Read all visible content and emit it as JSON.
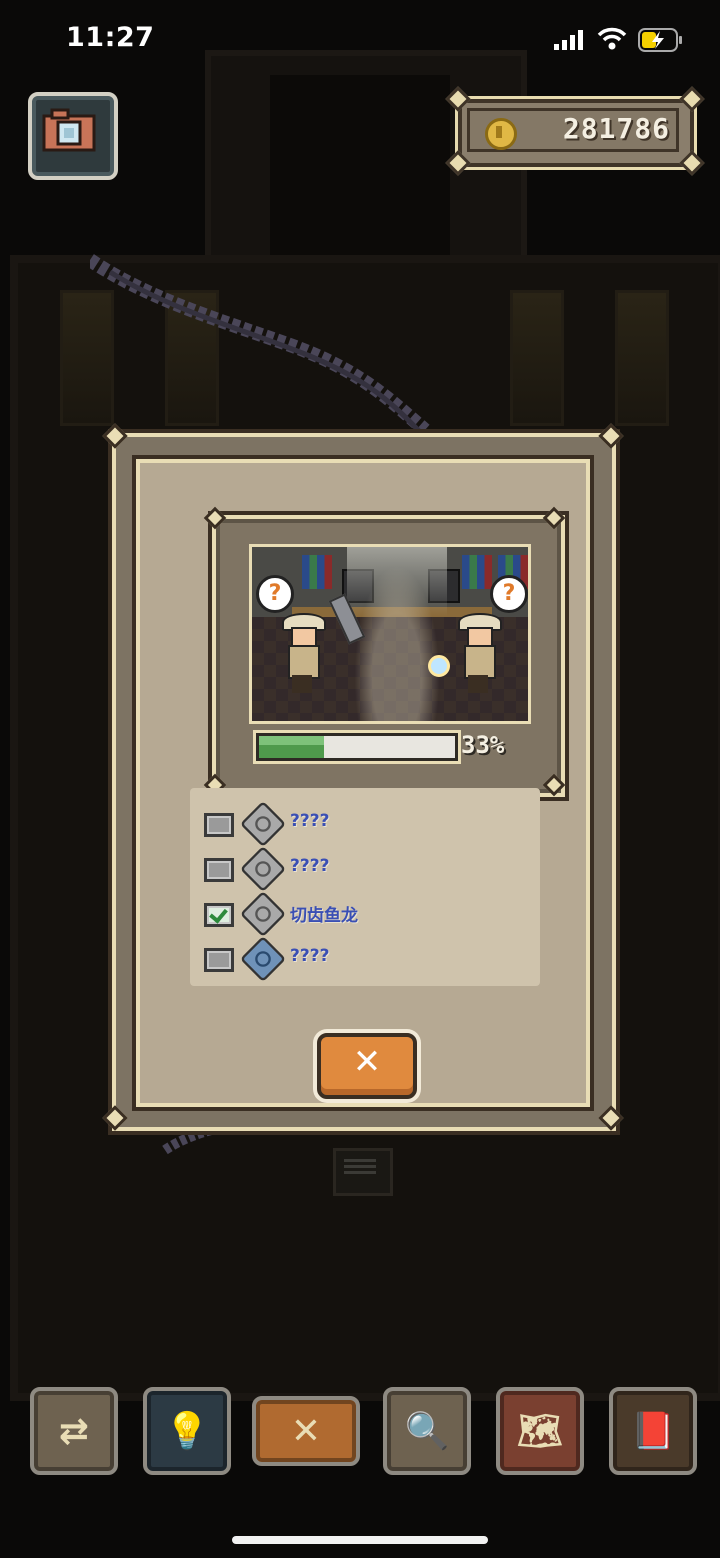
{
  "status_bar": {
    "time": "11:27"
  },
  "hud": {
    "coins": "281786",
    "camera_icon": "camera-icon",
    "coin_icon": "coin-icon"
  },
  "dialog": {
    "progress_percent": 33,
    "progress_label": "33%",
    "fossils": [
      {
        "name": "????",
        "checked": false,
        "icon": "fossil-gray-icon"
      },
      {
        "name": "????",
        "checked": false,
        "icon": "fossil-gray-icon"
      },
      {
        "name": "切齿鱼龙",
        "checked": true,
        "icon": "fossil-gray-icon"
      },
      {
        "name": "????",
        "checked": false,
        "icon": "fossil-blue-icon"
      }
    ],
    "close_glyph": "✕"
  },
  "toolbar": {
    "items": [
      {
        "name": "swap-icon",
        "glyph": "⇄"
      },
      {
        "name": "lightbulb-icon",
        "glyph": "💡"
      },
      {
        "name": "close-icon",
        "glyph": "✕"
      },
      {
        "name": "magnifier-question-icon",
        "glyph": "🔍"
      },
      {
        "name": "map-icon",
        "glyph": "🗺"
      },
      {
        "name": "book-icon",
        "glyph": "📕"
      }
    ]
  },
  "colors": {
    "accent_orange": "#e08a3e",
    "fossil_name_blue": "#3a4fb4",
    "progress_green": "#4f9a4c",
    "panel_tan": "#b6a993"
  }
}
